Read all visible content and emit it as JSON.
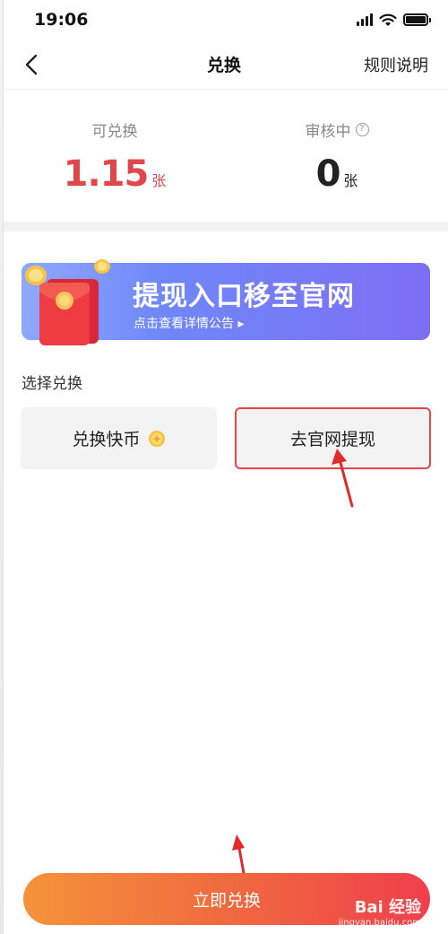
{
  "status_bar": {
    "time": "19:06"
  },
  "nav": {
    "title": "兑换",
    "rules_link": "规则说明"
  },
  "stats": {
    "available": {
      "label": "可兑换",
      "value": "1.15",
      "unit": "张",
      "color": "#e0464a"
    },
    "reviewing": {
      "label": "审核中",
      "value": "0",
      "unit": "张",
      "help_glyph": "?"
    }
  },
  "banner": {
    "title": "提现入口移至官网",
    "subtitle": "点击查看详情公告 ▸"
  },
  "section": {
    "label": "选择兑换"
  },
  "options": [
    {
      "label": "兑换快币",
      "icon": "coin-icon"
    },
    {
      "label": "去官网提现",
      "selected": true,
      "border_color": "#e2464a"
    }
  ],
  "submit": {
    "label": "立即兑换"
  },
  "watermark": {
    "logo": "Bai 经验",
    "url": "jingyan.baidu.com"
  },
  "colors": {
    "accent_red": "#e0464a",
    "button_gradient": [
      "#f4933a",
      "#ef3f4b"
    ],
    "banner_gradient": [
      "#8fa8ff",
      "#7d6ef4"
    ]
  }
}
